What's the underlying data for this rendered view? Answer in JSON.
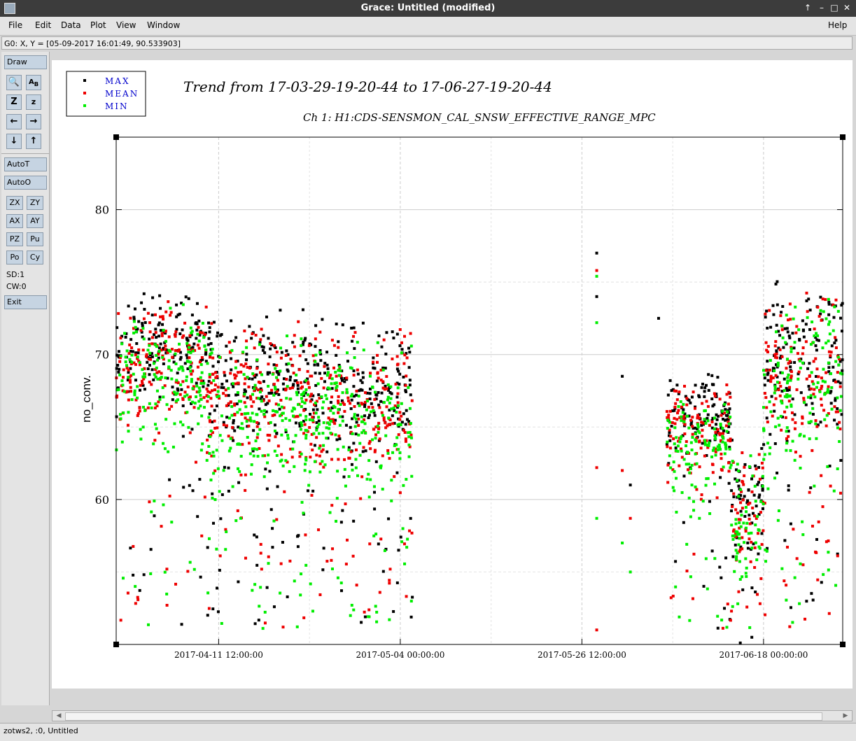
{
  "window": {
    "title": "Grace: Untitled (modified)"
  },
  "menu": {
    "file": "File",
    "edit": "Edit",
    "data": "Data",
    "plot": "Plot",
    "view": "View",
    "window": "Window",
    "help": "Help"
  },
  "locator": {
    "text": "G0: X, Y = [05-09-2017 16:01:49, 90.533903]"
  },
  "toolbar": {
    "draw": "Draw",
    "autot": "AutoT",
    "autoo": "AutoO",
    "zx": "ZX",
    "zy": "ZY",
    "ax": "AX",
    "ay": "AY",
    "pz": "PZ",
    "pu": "Pu",
    "po": "Po",
    "cy": "Cy",
    "sd": "SD:1",
    "cw": "CW:0",
    "exit": "Exit"
  },
  "status": {
    "text": "zotws2, :0, Untitled"
  },
  "colors": {
    "max": "#000000",
    "mean": "#ee0000",
    "min": "#00ee00",
    "legend_text": "#0000cc"
  },
  "chart_data": {
    "type": "scatter",
    "title": "Trend from 17-03-29-19-20-44 to 17-06-27-19-20-44",
    "subtitle": "Ch 1: H1:CDS-SENSMON_CAL_SNSW_EFFECTIVE_RANGE_MPC",
    "ylabel": "no_conv.",
    "xlabel": "",
    "xlim": [
      "2017-03-29 19:20:44",
      "2017-06-27 19:20:44"
    ],
    "ylim": [
      50,
      85
    ],
    "yticks": [
      60,
      70,
      80
    ],
    "xticks": [
      "2017-04-11 12:00:00",
      "2017-05-04 00:00:00",
      "2017-05-26 12:00:00",
      "2017-06-18 00:00:00"
    ],
    "grid": true,
    "legend": {
      "position": "top-left",
      "entries": [
        "MAX",
        "MEAN",
        "MIN"
      ]
    },
    "series": [
      {
        "name": "MAX",
        "color": "#000000",
        "segments": [
          {
            "x_start": "2017-03-29 19:20:44",
            "x_end": "2017-04-10 00:00:00",
            "y": [
              66,
              74.5
            ],
            "spikes_low": 51
          },
          {
            "x_start": "2017-04-10 00:00:00",
            "x_end": "2017-04-22 00:00:00",
            "y": [
              63,
              73.5
            ],
            "spikes_low": 51
          },
          {
            "x_start": "2017-04-22 00:00:00",
            "x_end": "2017-05-05 12:00:00",
            "y": [
              62,
              73
            ],
            "spikes_low": 51
          },
          {
            "x_start": "2017-06-06 00:00:00",
            "x_end": "2017-06-14 00:00:00",
            "y": [
              62,
              69
            ],
            "spikes_low": 51
          },
          {
            "x_start": "2017-06-14 00:00:00",
            "x_end": "2017-06-18 00:00:00",
            "y": [
              55,
              65
            ],
            "spikes_low": 50
          },
          {
            "x_start": "2017-06-18 00:00:00",
            "x_end": "2017-06-27 19:20:44",
            "y": [
              63,
              75.5
            ],
            "spikes_low": 51
          }
        ],
        "isolated": [
          [
            "2017-05-28 08:00:00",
            77.0
          ],
          [
            "2017-05-28 08:00:00",
            74.0
          ],
          [
            "2017-05-31 12:00:00",
            68.5
          ],
          [
            "2017-06-01 12:00:00",
            61.0
          ],
          [
            "2017-06-05 00:00:00",
            72.5
          ]
        ]
      },
      {
        "name": "MEAN",
        "color": "#ee0000",
        "segments": [
          {
            "x_start": "2017-03-29 19:20:44",
            "x_end": "2017-04-10 00:00:00",
            "y": [
              65,
              74
            ],
            "spikes_low": 51
          },
          {
            "x_start": "2017-04-10 00:00:00",
            "x_end": "2017-04-22 00:00:00",
            "y": [
              62,
              73
            ],
            "spikes_low": 51
          },
          {
            "x_start": "2017-04-22 00:00:00",
            "x_end": "2017-05-05 12:00:00",
            "y": [
              61,
              72.5
            ],
            "spikes_low": 51
          },
          {
            "x_start": "2017-06-06 00:00:00",
            "x_end": "2017-06-14 00:00:00",
            "y": [
              61,
              68.5
            ],
            "spikes_low": 51
          },
          {
            "x_start": "2017-06-14 00:00:00",
            "x_end": "2017-06-18 00:00:00",
            "y": [
              54,
              64
            ],
            "spikes_low": 50
          },
          {
            "x_start": "2017-06-18 00:00:00",
            "x_end": "2017-06-27 19:20:44",
            "y": [
              62,
              75
            ],
            "spikes_low": 51
          }
        ],
        "isolated": [
          [
            "2017-05-28 08:00:00",
            75.8
          ],
          [
            "2017-05-28 08:00:00",
            62.2
          ],
          [
            "2017-05-28 08:00:00",
            51.0
          ],
          [
            "2017-05-31 12:00:00",
            62.0
          ],
          [
            "2017-06-01 12:00:00",
            58.7
          ]
        ]
      },
      {
        "name": "MIN",
        "color": "#00ee00",
        "segments": [
          {
            "x_start": "2017-03-29 19:20:44",
            "x_end": "2017-04-10 00:00:00",
            "y": [
              63,
              73.5
            ],
            "spikes_low": 51
          },
          {
            "x_start": "2017-04-10 00:00:00",
            "x_end": "2017-04-22 00:00:00",
            "y": [
              60,
              72
            ],
            "spikes_low": 51
          },
          {
            "x_start": "2017-04-22 00:00:00",
            "x_end": "2017-05-05 12:00:00",
            "y": [
              59,
              71.5
            ],
            "spikes_low": 51
          },
          {
            "x_start": "2017-06-06 00:00:00",
            "x_end": "2017-06-14 00:00:00",
            "y": [
              60,
              68
            ],
            "spikes_low": 51
          },
          {
            "x_start": "2017-06-14 00:00:00",
            "x_end": "2017-06-18 00:00:00",
            "y": [
              53,
              63.5
            ],
            "spikes_low": 50
          },
          {
            "x_start": "2017-06-18 00:00:00",
            "x_end": "2017-06-27 19:20:44",
            "y": [
              61,
              74.5
            ],
            "spikes_low": 51
          }
        ],
        "isolated": [
          [
            "2017-05-28 08:00:00",
            75.4
          ],
          [
            "2017-05-28 08:00:00",
            72.2
          ],
          [
            "2017-05-28 08:00:00",
            58.7
          ],
          [
            "2017-05-31 12:00:00",
            57.0
          ],
          [
            "2017-06-01 12:00:00",
            55.0
          ]
        ]
      }
    ]
  }
}
